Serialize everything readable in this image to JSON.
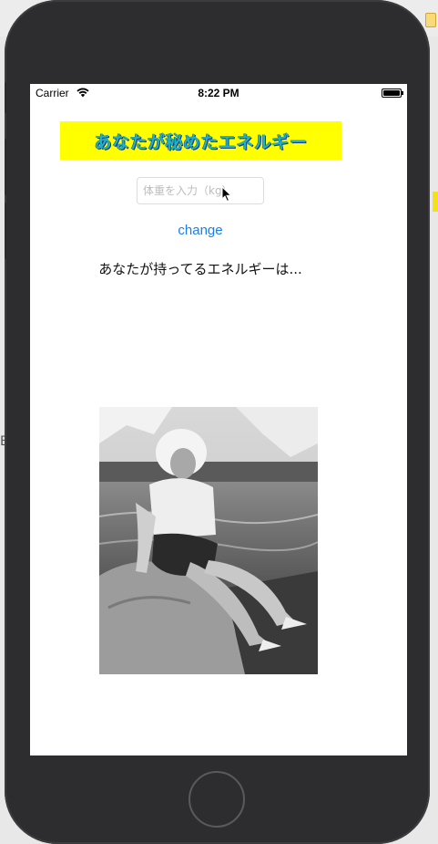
{
  "status_bar": {
    "carrier": "Carrier",
    "time": "8:22 PM"
  },
  "app": {
    "title": "あなたが秘めたエネルギー",
    "weight_input": {
      "placeholder": "体重を入力（kg）",
      "value": ""
    },
    "change_button": "change",
    "result_label": "あなたが持ってるエネルギーは..."
  },
  "background": {
    "left_text": "B"
  },
  "colors": {
    "banner_bg": "#ffff00",
    "banner_text": "#1eb2c4",
    "link_blue": "#1a7ef2",
    "device_body": "#2d2d2f"
  },
  "icons": {
    "signal": "wifi-icon",
    "battery": "battery-icon",
    "cursor": "mouse-pointer-icon",
    "home": "home-button"
  }
}
